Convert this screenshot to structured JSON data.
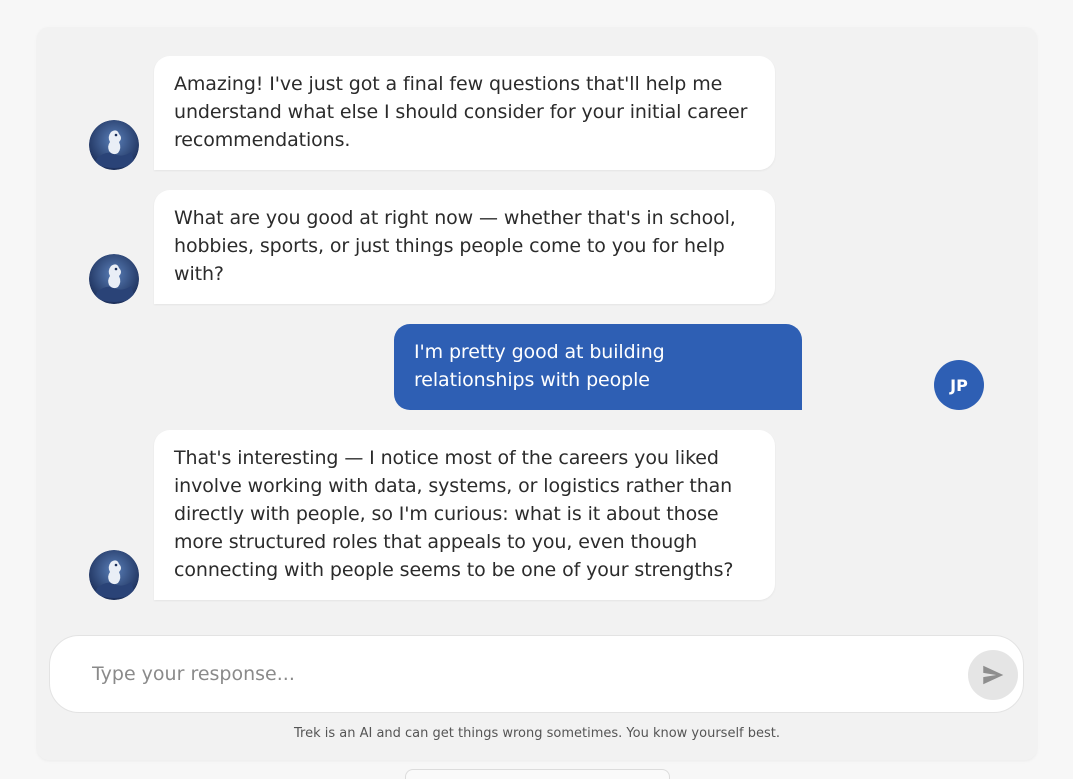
{
  "messages": [
    {
      "role": "bot",
      "text": "Amazing! I've just got a final few questions that'll help me understand what else I should consider for your initial career recommendations."
    },
    {
      "role": "bot",
      "text": "What are you good at right now — whether that's in school, hobbies, sports, or just things people come to you for help with?"
    },
    {
      "role": "user",
      "text": "I'm pretty good at building relationships with people",
      "avatar_initials": "JP"
    },
    {
      "role": "bot",
      "text": "That's interesting — I notice most of the careers you liked involve working with data, systems, or logistics rather than directly with people, so I'm curious: what is it about those more structured roles that appeals to you, even though connecting with people seems to be one of your strengths?"
    }
  ],
  "composer": {
    "placeholder": "Type your response...",
    "value": "",
    "send_icon": "send-icon"
  },
  "disclaimer": "Trek is an AI and can get things wrong sometimes. You know yourself best.",
  "colors": {
    "user_bubble": "#2e5fb4",
    "bot_bubble": "#ffffff",
    "background": "#f2f2f2"
  },
  "bot_avatar_icon": "trek-mascot-avatar"
}
